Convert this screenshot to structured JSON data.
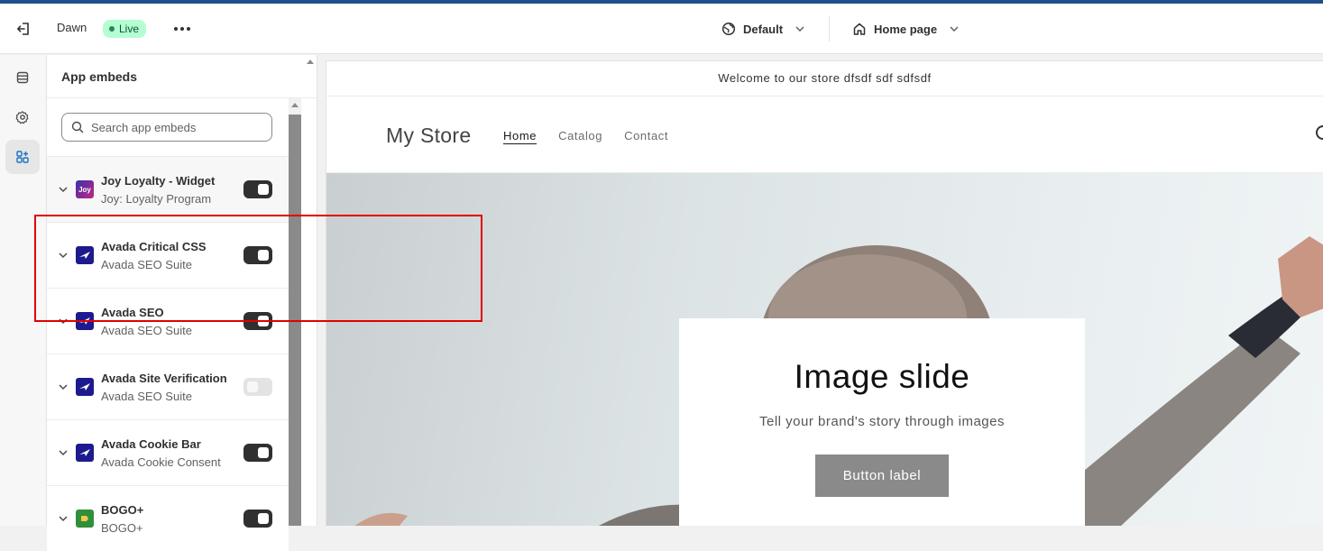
{
  "topbar": {
    "exit_icon": "exit-icon",
    "theme_name": "Dawn",
    "live_badge": "Live",
    "more_icon": "more-horizontal-icon",
    "locale_selector": {
      "icon": "globe-icon",
      "label": "Default"
    },
    "page_selector": {
      "icon": "home-icon",
      "label": "Home page"
    },
    "accent_color": "#1f4e8c"
  },
  "rail": {
    "items": [
      {
        "name": "sections",
        "icon": "sections-icon",
        "active": false
      },
      {
        "name": "theme-settings",
        "icon": "gear-icon",
        "active": false
      },
      {
        "name": "app-embeds",
        "icon": "apps-icon",
        "active": true
      }
    ]
  },
  "panel": {
    "title": "App embeds",
    "search": {
      "placeholder": "Search app embeds",
      "value": ""
    },
    "items": [
      {
        "title": "Joy Loyalty - Widget",
        "subtitle": "Joy: Loyalty Program",
        "logo_text": "Joy",
        "logo_color": "#2b2a8c",
        "enabled": true
      },
      {
        "title": "Avada Critical CSS",
        "subtitle": "Avada SEO Suite",
        "logo_text": "",
        "logo_color": "#1d1a8f",
        "enabled": true
      },
      {
        "title": "Avada SEO",
        "subtitle": "Avada SEO Suite",
        "logo_text": "",
        "logo_color": "#1d1a8f",
        "enabled": true
      },
      {
        "title": "Avada Site Verification",
        "subtitle": "Avada SEO Suite",
        "logo_text": "",
        "logo_color": "#1d1a8f",
        "enabled": false
      },
      {
        "title": "Avada Cookie Bar",
        "subtitle": "Avada Cookie Consent",
        "logo_text": "",
        "logo_color": "#1d1a8f",
        "enabled": true
      },
      {
        "title": "BOGO+",
        "subtitle": "BOGO+",
        "logo_text": "",
        "logo_color": "#2f8f3a",
        "enabled": true
      }
    ]
  },
  "preview": {
    "announcement": "Welcome to our store dfsdf sdf sdfsdf",
    "store_name": "My Store",
    "nav": [
      "Home",
      "Catalog",
      "Contact"
    ],
    "hero": {
      "title": "Image slide",
      "subtitle": "Tell your brand's story through images",
      "button": "Button label"
    }
  },
  "annotation": {
    "color": "#e00000"
  }
}
